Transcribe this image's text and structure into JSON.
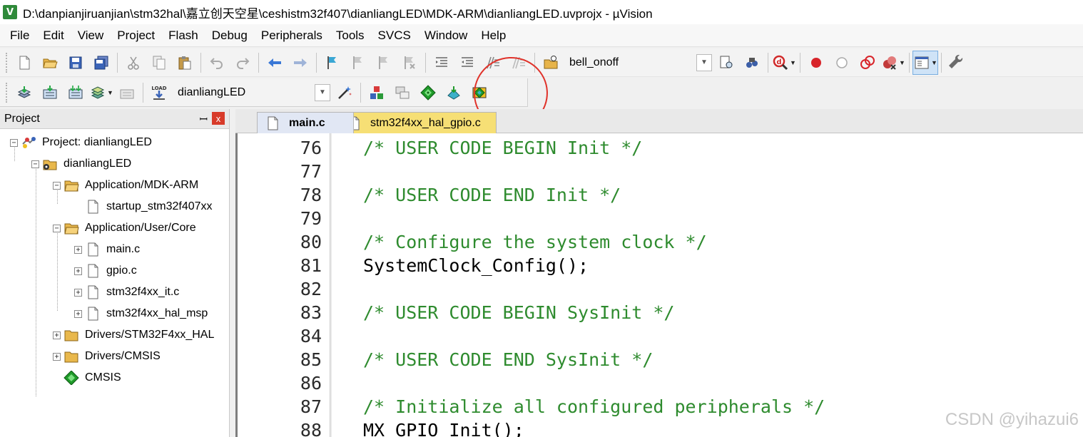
{
  "window": {
    "title": "D:\\danpianjiruanjian\\stm32hal\\嘉立创天空星\\ceshistm32f407\\dianliangLED\\MDK-ARM\\dianliangLED.uvprojx - µVision",
    "app_icon_letter": "V"
  },
  "menu": [
    "File",
    "Edit",
    "View",
    "Project",
    "Flash",
    "Debug",
    "Peripherals",
    "Tools",
    "SVCS",
    "Window",
    "Help"
  ],
  "toolbar1": {
    "find_combo_value": "bell_onoff"
  },
  "toolbar2": {
    "load_label": "LOAD",
    "target_combo_value": "dianliangLED"
  },
  "project_panel": {
    "title": "Project",
    "pin_glyph": "ꟷ",
    "close_glyph": "x",
    "tree": [
      {
        "label": "Project: dianliangLED",
        "expander": "−",
        "icon": "project-icon"
      },
      {
        "label": "dianliangLED",
        "expander": "−",
        "icon": "target-folder-icon"
      },
      {
        "label": "Application/MDK-ARM",
        "expander": "−",
        "icon": "folder-icon"
      },
      {
        "label": "startup_stm32f407xx",
        "expander": "",
        "icon": "file-icon"
      },
      {
        "label": "Application/User/Core",
        "expander": "−",
        "icon": "folder-icon"
      },
      {
        "label": "main.c",
        "expander": "+",
        "icon": "file-icon"
      },
      {
        "label": "gpio.c",
        "expander": "+",
        "icon": "file-icon"
      },
      {
        "label": "stm32f4xx_it.c",
        "expander": "+",
        "icon": "file-icon"
      },
      {
        "label": "stm32f4xx_hal_msp",
        "expander": "+",
        "icon": "file-icon"
      },
      {
        "label": "Drivers/STM32F4xx_HAL",
        "expander": "+",
        "icon": "folder-icon"
      },
      {
        "label": "Drivers/CMSIS",
        "expander": "+",
        "icon": "folder-icon"
      },
      {
        "label": "CMSIS",
        "expander": "",
        "icon": "cmsis-icon"
      }
    ]
  },
  "tabs": [
    {
      "label": "main.c",
      "active": true
    },
    {
      "label": "stm32f4xx_hal_gpio.c",
      "active": false
    }
  ],
  "code": [
    {
      "ln": "76",
      "text": "/* USER CODE BEGIN Init */",
      "kind": "comment"
    },
    {
      "ln": "77",
      "text": "",
      "kind": "plain"
    },
    {
      "ln": "78",
      "text": "/* USER CODE END Init */",
      "kind": "comment"
    },
    {
      "ln": "79",
      "text": "",
      "kind": "plain"
    },
    {
      "ln": "80",
      "text": "/* Configure the system clock */",
      "kind": "comment"
    },
    {
      "ln": "81",
      "text": "SystemClock_Config();",
      "kind": "plain"
    },
    {
      "ln": "82",
      "text": "",
      "kind": "plain"
    },
    {
      "ln": "83",
      "text": "/* USER CODE BEGIN SysInit */",
      "kind": "comment"
    },
    {
      "ln": "84",
      "text": "",
      "kind": "plain"
    },
    {
      "ln": "85",
      "text": "/* USER CODE END SysInit */",
      "kind": "comment"
    },
    {
      "ln": "86",
      "text": "",
      "kind": "plain"
    },
    {
      "ln": "87",
      "text": "/* Initialize all configured peripherals */",
      "kind": "comment"
    },
    {
      "ln": "88",
      "text": "MX_GPIO_Init();",
      "kind": "plain"
    }
  ],
  "watermark": "CSDN @yihazui6",
  "colors": {
    "comment": "#2e8b2e",
    "active_tab": "#e1e7f4",
    "inactive_tab": "#f6df75",
    "annotation": "#e0322a"
  }
}
